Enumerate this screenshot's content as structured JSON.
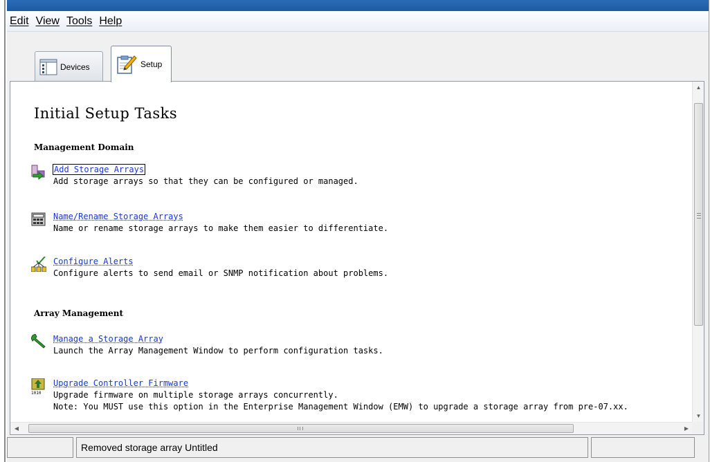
{
  "menu": {
    "items": [
      {
        "label": "Edit"
      },
      {
        "label": "View"
      },
      {
        "label": "Tools"
      },
      {
        "label": "Help"
      }
    ]
  },
  "tabs": [
    {
      "label": "Devices",
      "icon": "devices-icon",
      "active": false
    },
    {
      "label": "Setup",
      "icon": "setup-clipboard-icon",
      "active": true
    }
  ],
  "main": {
    "title": "Initial Setup Tasks",
    "sections": [
      {
        "heading": "Management Domain",
        "tasks": [
          {
            "link": "Add Storage Arrays",
            "description": "Add storage arrays so that they can be configured or managed.",
            "icon": "add-storage-arrays-icon"
          },
          {
            "link": "Name/Rename Storage Arrays",
            "description": "Name or rename storage arrays to make them easier to differentiate.",
            "icon": "rename-storage-arrays-icon"
          },
          {
            "link": "Configure Alerts",
            "description": "Configure alerts to send email or SNMP notification about problems.",
            "icon": "configure-alerts-icon"
          }
        ]
      },
      {
        "heading": "Array Management",
        "tasks": [
          {
            "link": "Manage a Storage Array",
            "description": "Launch the Array Management Window to perform configuration tasks.",
            "icon": "wrench-icon"
          },
          {
            "link": "Upgrade Controller Firmware",
            "description": "Upgrade firmware on multiple storage arrays concurrently.",
            "note": "Note: You MUST use this option in the Enterprise Management Window (EMW) to upgrade a storage array from pre-07.xx.",
            "icon": "firmware-upgrade-icon"
          }
        ]
      }
    ]
  },
  "status": {
    "message": "Removed storage array Untitled"
  },
  "colors": {
    "link": "#1a37d6",
    "titlebar": "#1d5aa4"
  }
}
